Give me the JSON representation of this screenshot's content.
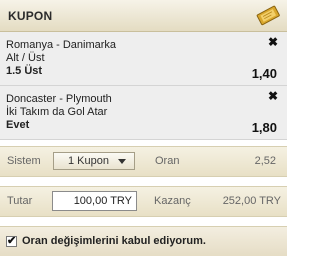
{
  "header": {
    "title": "KUPON",
    "icon": "ticket-icon"
  },
  "bets": [
    {
      "match": "Romanya - Danimarka",
      "market": "Alt / Üst",
      "selection": "1.5 Üst",
      "odds": "1,40"
    },
    {
      "match": "Doncaster - Plymouth",
      "market": "İki Takım da Gol Atar",
      "selection": "Evet",
      "odds": "1,80"
    }
  ],
  "system": {
    "label": "Sistem",
    "selected": "1 Kupon",
    "odds_label": "Oran",
    "odds_value": "2,52"
  },
  "stake": {
    "label": "Tutar",
    "amount": "100,00 TRY",
    "win_label": "Kazanç",
    "win_value": "252,00 TRY"
  },
  "accept": {
    "text": "Oran değişimlerini kabul ediyorum.",
    "checked": true
  },
  "colors": {
    "header_bg": "#e4dcc2",
    "bet_bg": "#eeeeee",
    "band_bg": "#ede6d0"
  }
}
